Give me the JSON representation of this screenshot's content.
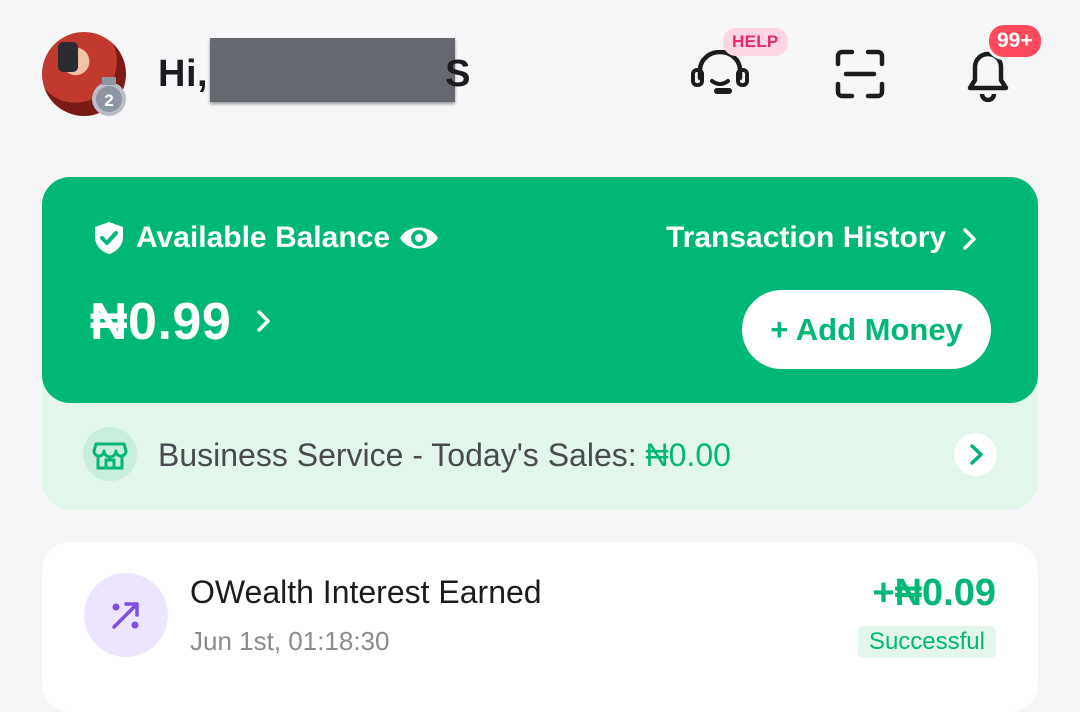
{
  "header": {
    "greeting_prefix": "Hi,",
    "greeting_suffix": "S",
    "help_badge": "HELP",
    "notifications_badge": "99+",
    "medal_rank": "2"
  },
  "balance": {
    "label": "Available Balance",
    "transaction_history_label": "Transaction History",
    "amount": "₦0.99",
    "add_money_label": "+ Add Money"
  },
  "business": {
    "label": "Business Service - Today's Sales: ",
    "sales_value": "₦0.00"
  },
  "transactions": [
    {
      "title": "OWealth Interest Earned",
      "date": "Jun 1st, 01:18:30",
      "amount": "+₦0.09",
      "status": "Successful"
    }
  ],
  "colors": {
    "brand_green": "#00b876",
    "strip_green": "#e2f6ec",
    "help_pink": "#e8296a",
    "badge_red": "#ff4a5e",
    "interest_purple": "#7d4ee0"
  },
  "icons": [
    "shield-check-icon",
    "eye-icon",
    "headset-icon",
    "scan-icon",
    "bell-icon",
    "store-icon",
    "percent-arrow-icon",
    "chevron-right-icon"
  ]
}
